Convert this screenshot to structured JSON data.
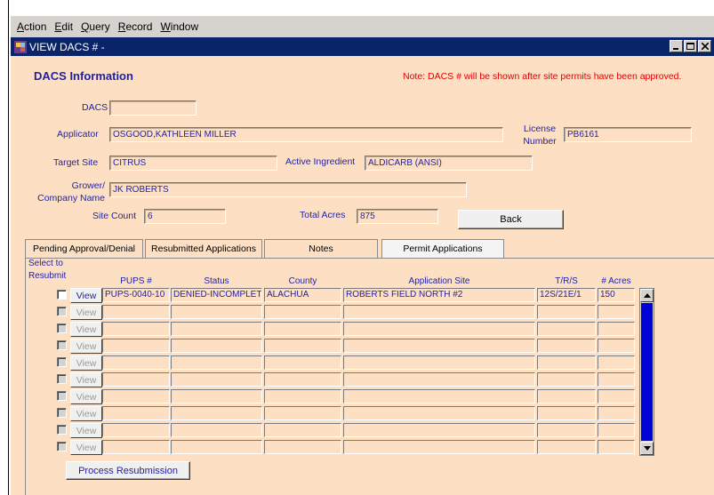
{
  "menu": [
    {
      "pre": "",
      "u": "A",
      "post": "ction"
    },
    {
      "pre": "",
      "u": "E",
      "post": "dit"
    },
    {
      "pre": "",
      "u": "Q",
      "post": "uery"
    },
    {
      "pre": "",
      "u": "R",
      "post": "ecord"
    },
    {
      "pre": "",
      "u": "W",
      "post": "indow"
    }
  ],
  "window": {
    "title": "VIEW DACS # -"
  },
  "header": {
    "title": "DACS Information",
    "note": "Note: DACS # will be shown after site permits have been approved."
  },
  "fields": {
    "dacs": {
      "label": "DACS #",
      "value": ""
    },
    "applicator": {
      "label": "Applicator",
      "value": "OSGOOD,KATHLEEN MILLER"
    },
    "license": {
      "label1": "License",
      "label2": "Number",
      "value": "PB6161"
    },
    "target_site": {
      "label": "Target Site",
      "value": "CITRUS"
    },
    "active_ingredient": {
      "label": "Active Ingredient",
      "value": "ALDICARB (ANSI)"
    },
    "grower": {
      "label1": "Grower/",
      "label2": "Company Name",
      "value": "JK ROBERTS"
    },
    "site_count": {
      "label": "Site Count",
      "value": "6"
    },
    "total_acres": {
      "label": "Total Acres",
      "value": "875"
    }
  },
  "buttons": {
    "back": "Back",
    "process": "Process Resubmission",
    "view": "View"
  },
  "tabs": [
    "Pending Approval/Denial",
    "Resubmitted Applications",
    "Notes",
    "Permit Applications"
  ],
  "grid": {
    "select_label1": "Select to",
    "select_label2": "Resubmit",
    "columns": {
      "pups": "PUPS #",
      "status": "Status",
      "county": "County",
      "site": "Application Site",
      "trs": "T/R/S",
      "acres": "# Acres"
    },
    "rows": [
      {
        "pups": "PUPS-0040-10",
        "status": "DENIED-INCOMPLETE",
        "county": "ALACHUA",
        "site": "ROBERTS FIELD NORTH #2",
        "trs": "12S/21E/1",
        "acres": "150"
      },
      {
        "pups": "",
        "status": "",
        "county": "",
        "site": "",
        "trs": "",
        "acres": ""
      },
      {
        "pups": "",
        "status": "",
        "county": "",
        "site": "",
        "trs": "",
        "acres": ""
      },
      {
        "pups": "",
        "status": "",
        "county": "",
        "site": "",
        "trs": "",
        "acres": ""
      },
      {
        "pups": "",
        "status": "",
        "county": "",
        "site": "",
        "trs": "",
        "acres": ""
      },
      {
        "pups": "",
        "status": "",
        "county": "",
        "site": "",
        "trs": "",
        "acres": ""
      },
      {
        "pups": "",
        "status": "",
        "county": "",
        "site": "",
        "trs": "",
        "acres": ""
      },
      {
        "pups": "",
        "status": "",
        "county": "",
        "site": "",
        "trs": "",
        "acres": ""
      },
      {
        "pups": "",
        "status": "",
        "county": "",
        "site": "",
        "trs": "",
        "acres": ""
      },
      {
        "pups": "",
        "status": "",
        "county": "",
        "site": "",
        "trs": "",
        "acres": ""
      }
    ]
  },
  "icons": {
    "app": "forms-app-icon",
    "minimize": "minimize-icon",
    "maximize": "maximize-icon",
    "close": "close-icon",
    "up": "arrow-up-icon",
    "down": "arrow-down-icon"
  },
  "colors": {
    "titlebar": "#0a246a",
    "canvas": "#fde0c4",
    "label": "#1f1fa6",
    "note": "#e00000",
    "scroll_thumb": "#0000d8"
  }
}
